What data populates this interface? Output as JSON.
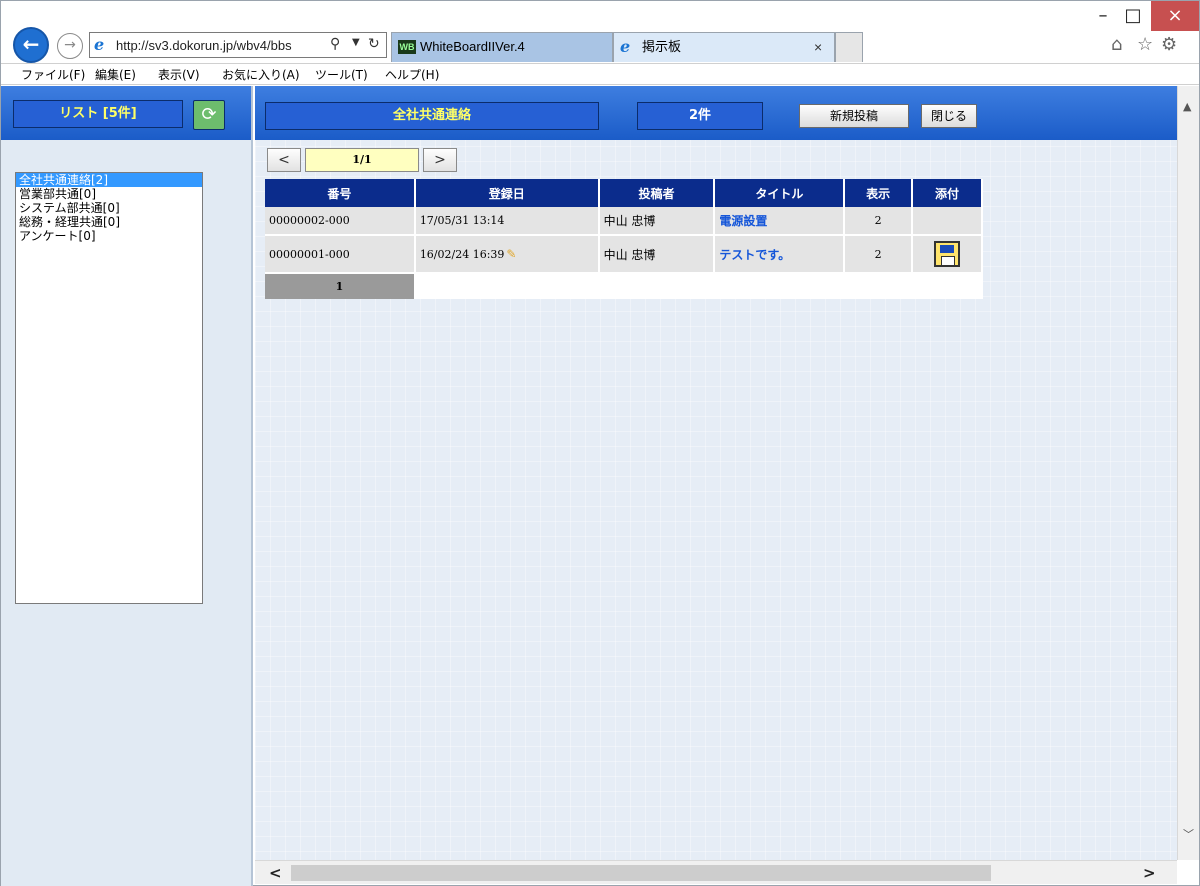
{
  "browser": {
    "url": "http://sv3.dokorun.jp/wbv4/bbs",
    "tabs": [
      {
        "label": "WhiteBoardIIVer.4"
      },
      {
        "label": "掲示板"
      }
    ],
    "tab_wb_icon_text": "WB",
    "tab_close": "×",
    "back_glyph": "←",
    "forward_glyph": "→",
    "window_controls": {
      "minimize": "–",
      "maximize": "□",
      "close": "×"
    },
    "toolbar_icons": [
      "home-icon",
      "star-icon",
      "gear-icon"
    ]
  },
  "menu": [
    "ファイル(F)",
    "編集(E)",
    "表示(V)",
    "お気に入り(A)",
    "ツール(T)",
    "ヘルプ(H)"
  ],
  "sidebar": {
    "title": "リスト [5件]",
    "categories": [
      {
        "label": "全社共通連絡[2]",
        "selected": true
      },
      {
        "label": "営業部共通[0]",
        "selected": false
      },
      {
        "label": "システム部共通[0]",
        "selected": false
      },
      {
        "label": "総務・経理共通[0]",
        "selected": false
      },
      {
        "label": "アンケート[0]",
        "selected": false
      }
    ]
  },
  "board": {
    "title": "全社共通連絡",
    "count": "2件",
    "new_post_label": "新規投稿",
    "close_label": "閉じる",
    "pager": {
      "prev": "<",
      "next": ">",
      "indicator": "1/1"
    },
    "columns": [
      "番号",
      "登録日",
      "投稿者",
      "タイトル",
      "表示",
      "添付"
    ],
    "rows": [
      {
        "number": "00000002-000",
        "date": "17/05/31 13:14",
        "poster": "中山 忠博",
        "title": "電源設置",
        "views": "2",
        "has_edit_icon": false,
        "has_attachment": false
      },
      {
        "number": "00000001-000",
        "date": "16/02/24 16:39",
        "poster": "中山 忠博",
        "title": "テストです。",
        "views": "2",
        "has_edit_icon": true,
        "has_attachment": true
      }
    ],
    "page_number": "1"
  },
  "colors": {
    "header_blue": "#1b5cc8",
    "table_header": "#0b2c8c",
    "title_yellow": "#ffff66",
    "link_blue": "#1556d9"
  }
}
